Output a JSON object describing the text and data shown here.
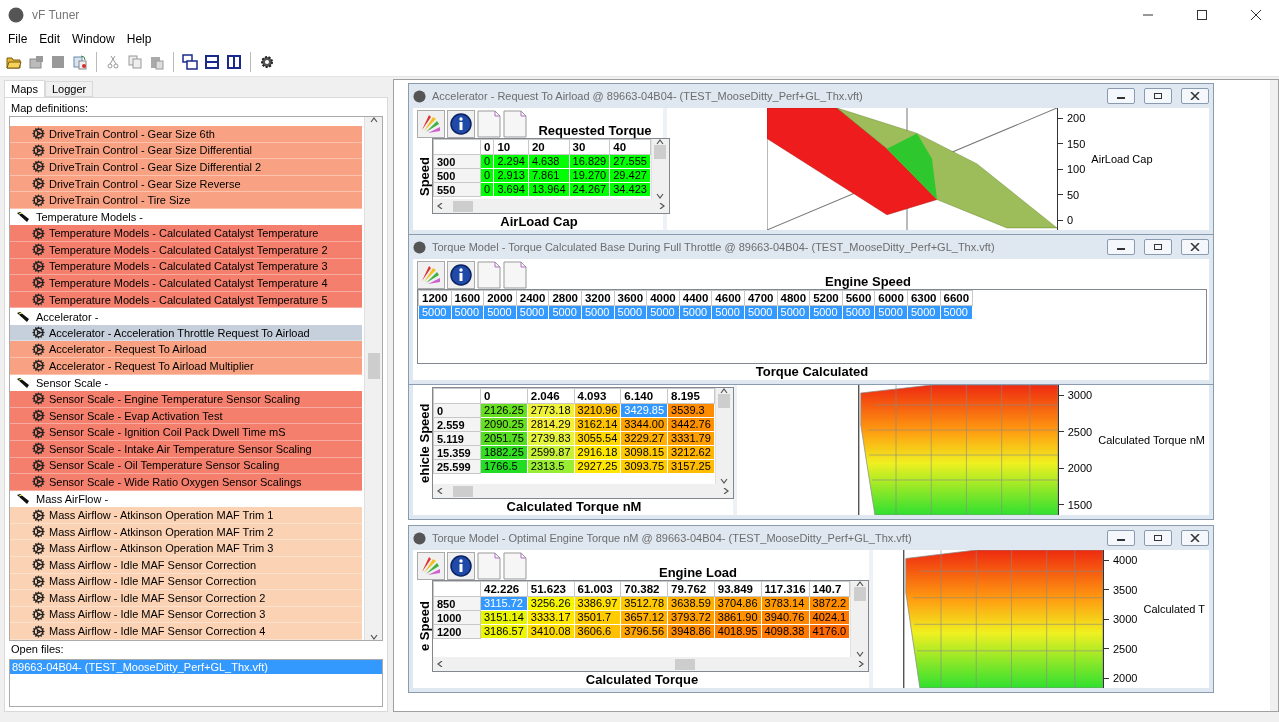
{
  "window": {
    "title": "vF Tuner"
  },
  "menu": [
    "File",
    "Edit",
    "Window",
    "Help"
  ],
  "left_tabs": [
    {
      "label": "Maps",
      "selected": true
    },
    {
      "label": "Logger",
      "selected": false
    }
  ],
  "map_definitions": {
    "label": "Map definitions:",
    "groups": [
      {
        "children": [
          {
            "label": "DriveTrain Control - Gear Size 6th",
            "selected": false,
            "color": "#f9a283"
          },
          {
            "label": "DriveTrain Control - Gear Size Differential",
            "selected": false,
            "color": "#f9a283"
          },
          {
            "label": "DriveTrain Control - Gear Size Differential 2",
            "selected": false,
            "color": "#f9a283"
          },
          {
            "label": "DriveTrain Control - Gear Size Reverse",
            "selected": false,
            "color": "#f9a283"
          },
          {
            "label": "DriveTrain Control - Tire Size",
            "selected": false,
            "color": "#f9a283"
          }
        ]
      },
      {
        "label": "Temperature Models -",
        "children": [
          {
            "label": "Temperature Models - Calculated Catalyst Temperature",
            "selected": false,
            "color": "#f47f6d"
          },
          {
            "label": "Temperature Models - Calculated Catalyst Temperature 2",
            "selected": false,
            "color": "#f47f6d"
          },
          {
            "label": "Temperature Models - Calculated Catalyst Temperature 3",
            "selected": false,
            "color": "#f47f6d"
          },
          {
            "label": "Temperature Models - Calculated Catalyst Temperature 4",
            "selected": false,
            "color": "#f47f6d"
          },
          {
            "label": "Temperature Models - Calculated Catalyst Temperature 5",
            "selected": false,
            "color": "#f47f6d"
          }
        ]
      },
      {
        "label": "Accelerator -",
        "children": [
          {
            "label": "Accelerator - Acceleration Throttle Request To Airload",
            "selected": true
          },
          {
            "label": "Accelerator - Request To Airload",
            "selected": false,
            "color": "#f9a283"
          },
          {
            "label": "Accelerator - Request To Airload Multiplier",
            "selected": false,
            "color": "#f9a283"
          }
        ]
      },
      {
        "label": "Sensor Scale -",
        "children": [
          {
            "label": "Sensor Scale - Engine Temperature Sensor Scaling",
            "selected": false,
            "color": "#f47f6d"
          },
          {
            "label": "Sensor Scale - Evap Activation Test",
            "selected": false,
            "color": "#f47f6d"
          },
          {
            "label": "Sensor Scale - Ignition Coil Pack Dwell Time mS",
            "selected": false,
            "color": "#f47f6d"
          },
          {
            "label": "Sensor Scale - Intake Air Temperature Sensor Scaling",
            "selected": false,
            "color": "#f47f6d"
          },
          {
            "label": "Sensor Scale - Oil Temperature Sensor Scaling",
            "selected": false,
            "color": "#f47f6d"
          },
          {
            "label": "Sensor Scale - Wide Ratio Oxygen Sensor Scalings",
            "selected": false,
            "color": "#f47f6d"
          }
        ]
      },
      {
        "label": "Mass AirFlow -",
        "children": [
          {
            "label": "Mass Airflow - Atkinson Operation MAF Trim 1",
            "selected": false,
            "color": "#fbd2b4"
          },
          {
            "label": "Mass Airflow - Atkinson Operation MAF Trim 2",
            "selected": false,
            "color": "#fbd2b4"
          },
          {
            "label": "Mass Airflow - Atkinson Operation MAF Trim 3",
            "selected": false,
            "color": "#fbd2b4"
          },
          {
            "label": "Mass Airflow - Idle MAF Sensor Correction",
            "selected": false,
            "color": "#fbd2b4"
          },
          {
            "label": "Mass Airflow - Idle MAF Sensor Correction",
            "selected": false,
            "color": "#fbd2b4"
          },
          {
            "label": "Mass Airflow - Idle MAF Sensor Correction 2",
            "selected": false,
            "color": "#fbd2b4"
          },
          {
            "label": "Mass Airflow - Idle MAF Sensor Correction 3",
            "selected": false,
            "color": "#fbd2b4"
          },
          {
            "label": "Mass Airflow - Idle MAF Sensor Correction 4",
            "selected": false,
            "color": "#fbd2b4"
          }
        ]
      }
    ]
  },
  "open_files": {
    "label": "Open files:",
    "items": [
      {
        "label": "89663-04B04- (TEST_MooseDitty_Perf+GL_Thx.vft)",
        "selected": true
      }
    ]
  },
  "map_windows": [
    {
      "title": "Accelerator - Request To Airload @ 89663-04B04- (TEST_MooseDitty_Perf+GL_Thx.vft)",
      "x_title": "Requested Torque",
      "y_title": "Speed",
      "z_title": "AirLoad Cap",
      "columns": [
        "0",
        "10",
        "20",
        "30",
        "40"
      ],
      "rows": [
        {
          "header": "300",
          "cells": [
            {
              "value": "0",
              "color": "#00ff00",
              "selected": false
            },
            {
              "value": "2.294",
              "color": "#00ff00",
              "selected": false
            },
            {
              "value": "4.638",
              "color": "#00ff00",
              "selected": false
            },
            {
              "value": "16.829",
              "color": "#00ff00",
              "selected": false
            },
            {
              "value": "27.555",
              "color": "#00ff00",
              "selected": false
            }
          ]
        },
        {
          "header": "500",
          "cells": [
            {
              "value": "0",
              "color": "#00ff00",
              "selected": false
            },
            {
              "value": "2.913",
              "color": "#00ff00",
              "selected": false
            },
            {
              "value": "7.861",
              "color": "#00ff00",
              "selected": false
            },
            {
              "value": "19.270",
              "color": "#00ff00",
              "selected": false
            },
            {
              "value": "29.427",
              "color": "#00ff00",
              "selected": false
            }
          ]
        },
        {
          "header": "550",
          "cells": [
            {
              "value": "0",
              "color": "#00ff00",
              "selected": false
            },
            {
              "value": "3.694",
              "color": "#00ff00",
              "selected": false
            },
            {
              "value": "13.964",
              "color": "#00ff00",
              "selected": false
            },
            {
              "value": "24.267",
              "color": "#00ff00",
              "selected": false
            },
            {
              "value": "34.423",
              "color": "#00ff00",
              "selected": false
            }
          ]
        }
      ],
      "surface_plot": {
        "kind": "slope",
        "axis_ticks": [
          "200",
          "150",
          "100",
          "50",
          "0"
        ],
        "axis_title": "AirLoad Cap"
      }
    },
    {
      "title": "Torque Model - Torque Calculated Base During Full Throttle @ 89663-04B04- (TEST_MooseDitty_Perf+GL_Thx.vft)",
      "x_title": "Engine Speed",
      "z_title": "Torque Calculated",
      "columns": [
        "1200",
        "1600",
        "2000",
        "2400",
        "2800",
        "3200",
        "3600",
        "4000",
        "4400",
        "4600",
        "4700",
        "4800",
        "5200",
        "5600",
        "6000",
        "6300",
        "6600"
      ],
      "rows": [
        {
          "cells": [
            {
              "value": "5000",
              "color": "#3399ff",
              "selected": true
            },
            {
              "value": "5000",
              "color": "#3399ff",
              "selected": true
            },
            {
              "value": "5000",
              "color": "#3399ff",
              "selected": true
            },
            {
              "value": "5000",
              "color": "#3399ff",
              "selected": true
            },
            {
              "value": "5000",
              "color": "#3399ff",
              "selected": true
            },
            {
              "value": "5000",
              "color": "#3399ff",
              "selected": true
            },
            {
              "value": "5000",
              "color": "#3399ff",
              "selected": true
            },
            {
              "value": "5000",
              "color": "#3399ff",
              "selected": true
            },
            {
              "value": "5000",
              "color": "#3399ff",
              "selected": true
            },
            {
              "value": "5000",
              "color": "#3399ff",
              "selected": true
            },
            {
              "value": "5000",
              "color": "#3399ff",
              "selected": true
            },
            {
              "value": "5000",
              "color": "#3399ff",
              "selected": true
            },
            {
              "value": "5000",
              "color": "#3399ff",
              "selected": true
            },
            {
              "value": "5000",
              "color": "#3399ff",
              "selected": true
            },
            {
              "value": "5000",
              "color": "#3399ff",
              "selected": true
            },
            {
              "value": "5000",
              "color": "#3399ff",
              "selected": true
            },
            {
              "value": "5000",
              "color": "#3399ff",
              "selected": true
            }
          ]
        }
      ]
    },
    {
      "y_title": "ehicle Speed",
      "z_title": "Calculated Torque nM",
      "columns": [
        "0",
        "2.046",
        "4.093",
        "6.140",
        "8.195"
      ],
      "rows": [
        {
          "header": "0",
          "cells": [
            {
              "value": "2126.25",
              "color": "#66e020",
              "selected": false
            },
            {
              "value": "2773.18",
              "color": "#eef23a",
              "selected": false
            },
            {
              "value": "3210.96",
              "color": "#ffc000",
              "selected": false
            },
            {
              "value": "3429.85",
              "color": "#3399ff",
              "selected": true
            },
            {
              "value": "3539.3",
              "color": "#ff8c00",
              "selected": false
            }
          ]
        },
        {
          "header": "2.559",
          "cells": [
            {
              "value": "2090.25",
              "color": "#66e020",
              "selected": false
            },
            {
              "value": "2814.29",
              "color": "#f6ef3a",
              "selected": false
            },
            {
              "value": "3162.14",
              "color": "#ffc400",
              "selected": false
            },
            {
              "value": "3344.00",
              "color": "#ffa200",
              "selected": false
            },
            {
              "value": "3442.76",
              "color": "#ff9000",
              "selected": false
            }
          ]
        },
        {
          "header": "5.119",
          "cells": [
            {
              "value": "2051.75",
              "color": "#55dd22",
              "selected": false
            },
            {
              "value": "2739.83",
              "color": "#e4f43a",
              "selected": false
            },
            {
              "value": "3055.54",
              "color": "#ffd700",
              "selected": false
            },
            {
              "value": "3229.27",
              "color": "#ffb000",
              "selected": false
            },
            {
              "value": "3331.79",
              "color": "#ffa000",
              "selected": false
            }
          ]
        },
        {
          "header": "15.359",
          "cells": [
            {
              "value": "1882.25",
              "color": "#33dd22",
              "selected": false
            },
            {
              "value": "2599.87",
              "color": "#c8f03a",
              "selected": false
            },
            {
              "value": "2916.18",
              "color": "#ffe800",
              "selected": false
            },
            {
              "value": "3098.15",
              "color": "#ffc800",
              "selected": false
            },
            {
              "value": "3212.62",
              "color": "#ffb400",
              "selected": false
            }
          ]
        },
        {
          "header": "25.599",
          "cells": [
            {
              "value": "1766.5",
              "color": "#22dd22",
              "selected": false
            },
            {
              "value": "2313.5",
              "color": "#99ee33",
              "selected": false
            },
            {
              "value": "2927.25",
              "color": "#ffe600",
              "selected": false
            },
            {
              "value": "3093.75",
              "color": "#ffcc00",
              "selected": false
            },
            {
              "value": "3157.25",
              "color": "#ffbc00",
              "selected": false
            }
          ]
        }
      ],
      "surface_plot": {
        "kind": "gradient",
        "axis_ticks": [
          "3000",
          "2500",
          "2000",
          "1500"
        ],
        "axis_title": "Calculated Torque nM"
      }
    },
    {
      "title": "Torque Model - Optimal Engine Torque nM @ 89663-04B04- (TEST_MooseDitty_Perf+GL_Thx.vft)",
      "x_title": "Engine Load",
      "y_title": "e Speed",
      "z_title": "Calculated Torque",
      "columns": [
        "42.226",
        "51.623",
        "61.003",
        "70.382",
        "79.762",
        "93.849",
        "117.316",
        "140.7"
      ],
      "rows": [
        {
          "header": "850",
          "cells": [
            {
              "value": "3115.72",
              "color": "#3399ff",
              "selected": true
            },
            {
              "value": "3256.26",
              "color": "#f5f500",
              "selected": false
            },
            {
              "value": "3386.97",
              "color": "#ffe000",
              "selected": false
            },
            {
              "value": "3512.78",
              "color": "#ffc800",
              "selected": false
            },
            {
              "value": "3638.59",
              "color": "#ffb000",
              "selected": false
            },
            {
              "value": "3704.86",
              "color": "#ffa000",
              "selected": false
            },
            {
              "value": "3783.14",
              "color": "#ff9800",
              "selected": false
            },
            {
              "value": "3872.2",
              "color": "#ff8c00",
              "selected": false
            }
          ]
        },
        {
          "header": "1000",
          "cells": [
            {
              "value": "3151.14",
              "color": "#e8f500",
              "selected": false
            },
            {
              "value": "3333.17",
              "color": "#ffe800",
              "selected": false
            },
            {
              "value": "3501.7",
              "color": "#ffcc00",
              "selected": false
            },
            {
              "value": "3657.12",
              "color": "#ffb000",
              "selected": false
            },
            {
              "value": "3793.72",
              "color": "#ff9c00",
              "selected": false
            },
            {
              "value": "3861.90",
              "color": "#ff9000",
              "selected": false
            },
            {
              "value": "3940.76",
              "color": "#ff8800",
              "selected": false
            },
            {
              "value": "4024.1",
              "color": "#ff7a00",
              "selected": false
            }
          ]
        },
        {
          "header": "1200",
          "cells": [
            {
              "value": "3186.57",
              "color": "#eef500",
              "selected": false
            },
            {
              "value": "3410.08",
              "color": "#ffdc00",
              "selected": false
            },
            {
              "value": "3606.6",
              "color": "#ffc000",
              "selected": false
            },
            {
              "value": "3796.56",
              "color": "#ffa400",
              "selected": false
            },
            {
              "value": "3948.86",
              "color": "#ff8c00",
              "selected": false
            },
            {
              "value": "4018.95",
              "color": "#ff8000",
              "selected": false
            },
            {
              "value": "4098.38",
              "color": "#ff7800",
              "selected": false
            },
            {
              "value": "4176.0",
              "color": "#ff6a00",
              "selected": false
            }
          ]
        }
      ],
      "surface_plot": {
        "kind": "gradient",
        "axis_ticks": [
          "4000",
          "3500",
          "3000",
          "2500",
          "2000"
        ],
        "axis_title": "Calculated T"
      }
    }
  ]
}
